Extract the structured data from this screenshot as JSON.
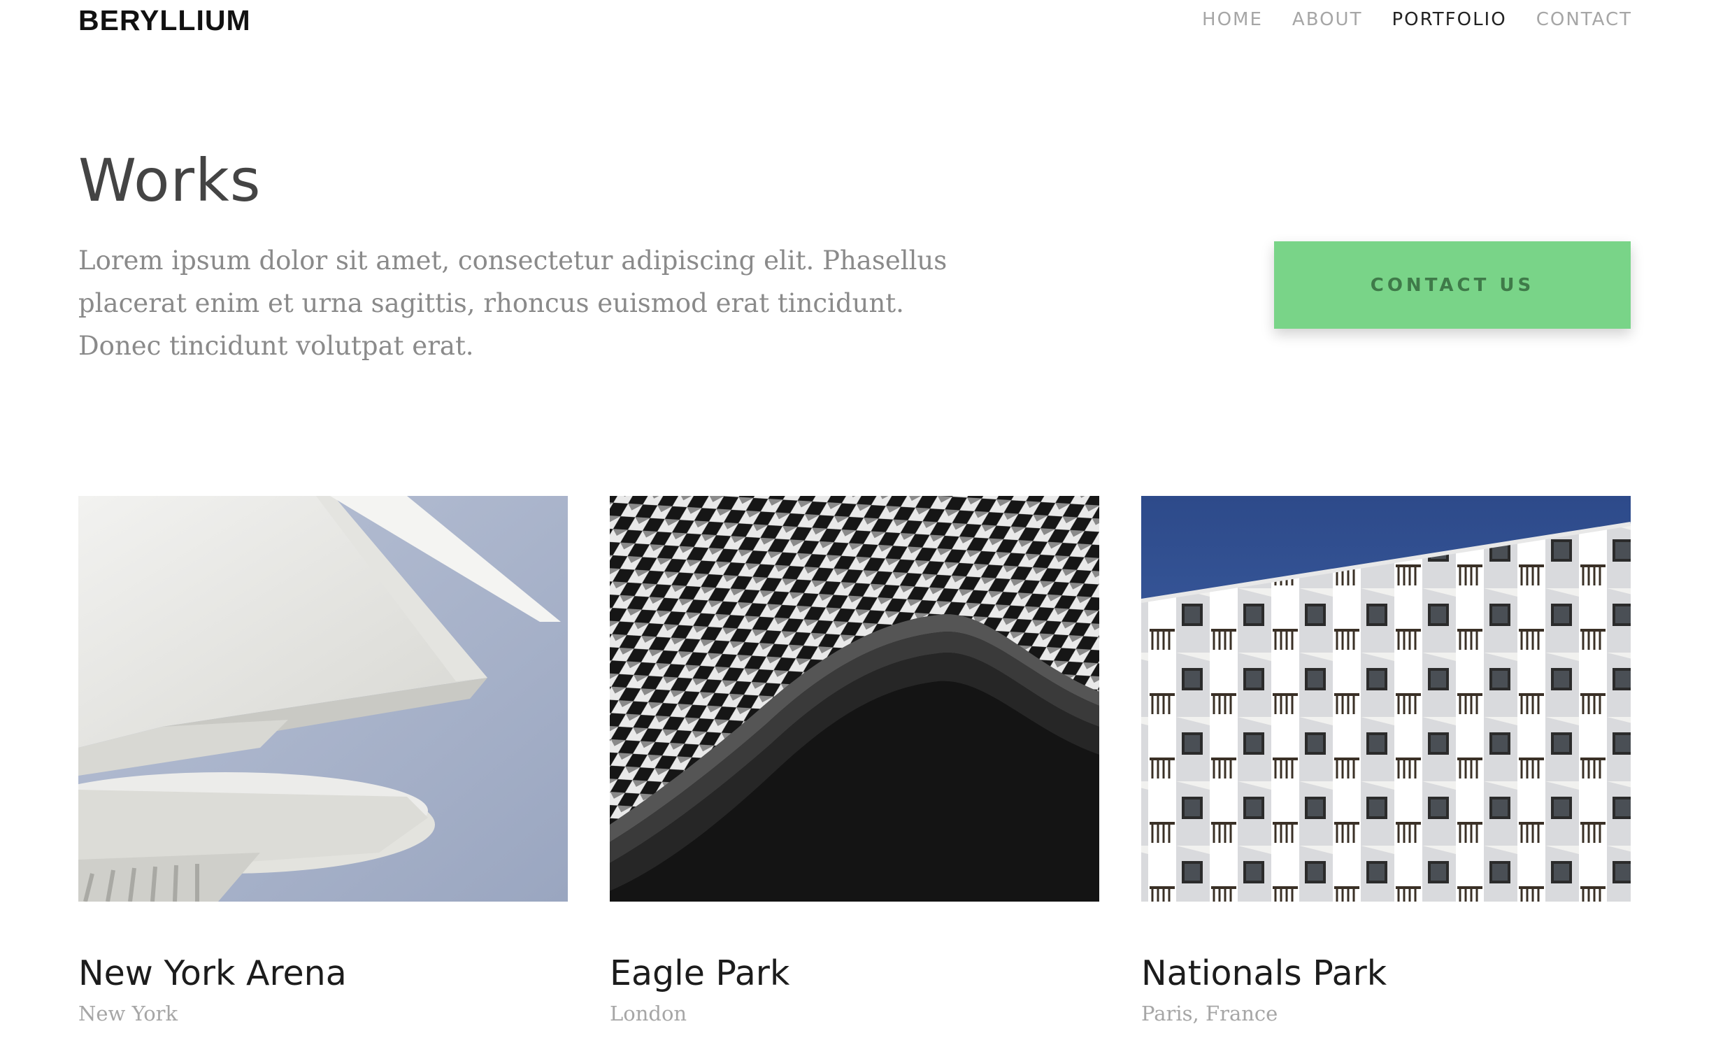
{
  "header": {
    "brand": "BERYLLIUM",
    "nav": [
      {
        "label": "HOME",
        "active": false
      },
      {
        "label": "ABOUT",
        "active": false
      },
      {
        "label": "PORTFOLIO",
        "active": true
      },
      {
        "label": "CONTACT",
        "active": false
      }
    ]
  },
  "intro": {
    "title": "Works",
    "description": "Lorem ipsum dolor sit amet, consectetur adipiscing elit. Phasellus placerat enim et urna sagittis, rhoncus euismod erat tincidunt. Donec tincidunt volutpat erat.",
    "cta_label": "CONTACT US"
  },
  "projects": [
    {
      "title": "New York Arena",
      "location": "New York",
      "image": "white-curved-architecture-photo"
    },
    {
      "title": "Eagle Park",
      "location": "London",
      "image": "black-white-woven-facade-photo"
    },
    {
      "title": "Nationals Park",
      "location": "Paris, France",
      "image": "white-apartment-balconies-photo"
    }
  ],
  "colors": {
    "accent": "#79d488",
    "accent_text": "#3f7a49",
    "nav_active": "#222222",
    "nav_inactive": "#a6a6a6",
    "muted_text": "#8a8a8a"
  }
}
